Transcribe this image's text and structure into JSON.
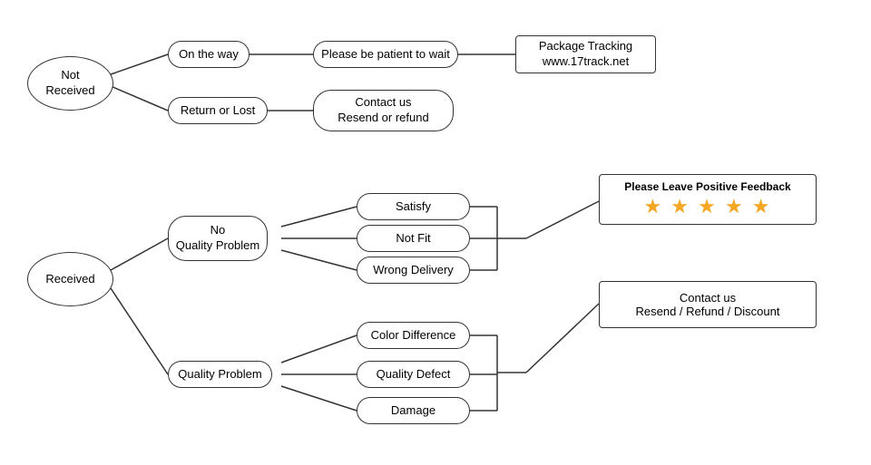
{
  "nodes": {
    "not_received": {
      "label": "Not\nReceived"
    },
    "on_the_way": {
      "label": "On the way"
    },
    "return_or_lost": {
      "label": "Return or Lost"
    },
    "patient_wait": {
      "label": "Please be patient to wait"
    },
    "contact_resend_refund": {
      "label": "Contact us\nResend or refund"
    },
    "package_tracking": {
      "label": "Package Tracking\nwww.17track.net"
    },
    "received": {
      "label": "Received"
    },
    "no_quality_problem": {
      "label": "No\nQuality Problem"
    },
    "quality_problem": {
      "label": "Quality Problem"
    },
    "satisfy": {
      "label": "Satisfy"
    },
    "not_fit": {
      "label": "Not Fit"
    },
    "wrong_delivery": {
      "label": "Wrong Delivery"
    },
    "color_difference": {
      "label": "Color Difference"
    },
    "quality_defect": {
      "label": "Quality Defect"
    },
    "damage": {
      "label": "Damage"
    },
    "please_feedback": {
      "label": "Please Leave Positive Feedback"
    },
    "contact_resend_refund_discount": {
      "label": "Contact us\nResend / Refund / Discount"
    },
    "stars": {
      "label": "★ ★ ★ ★ ★"
    }
  }
}
